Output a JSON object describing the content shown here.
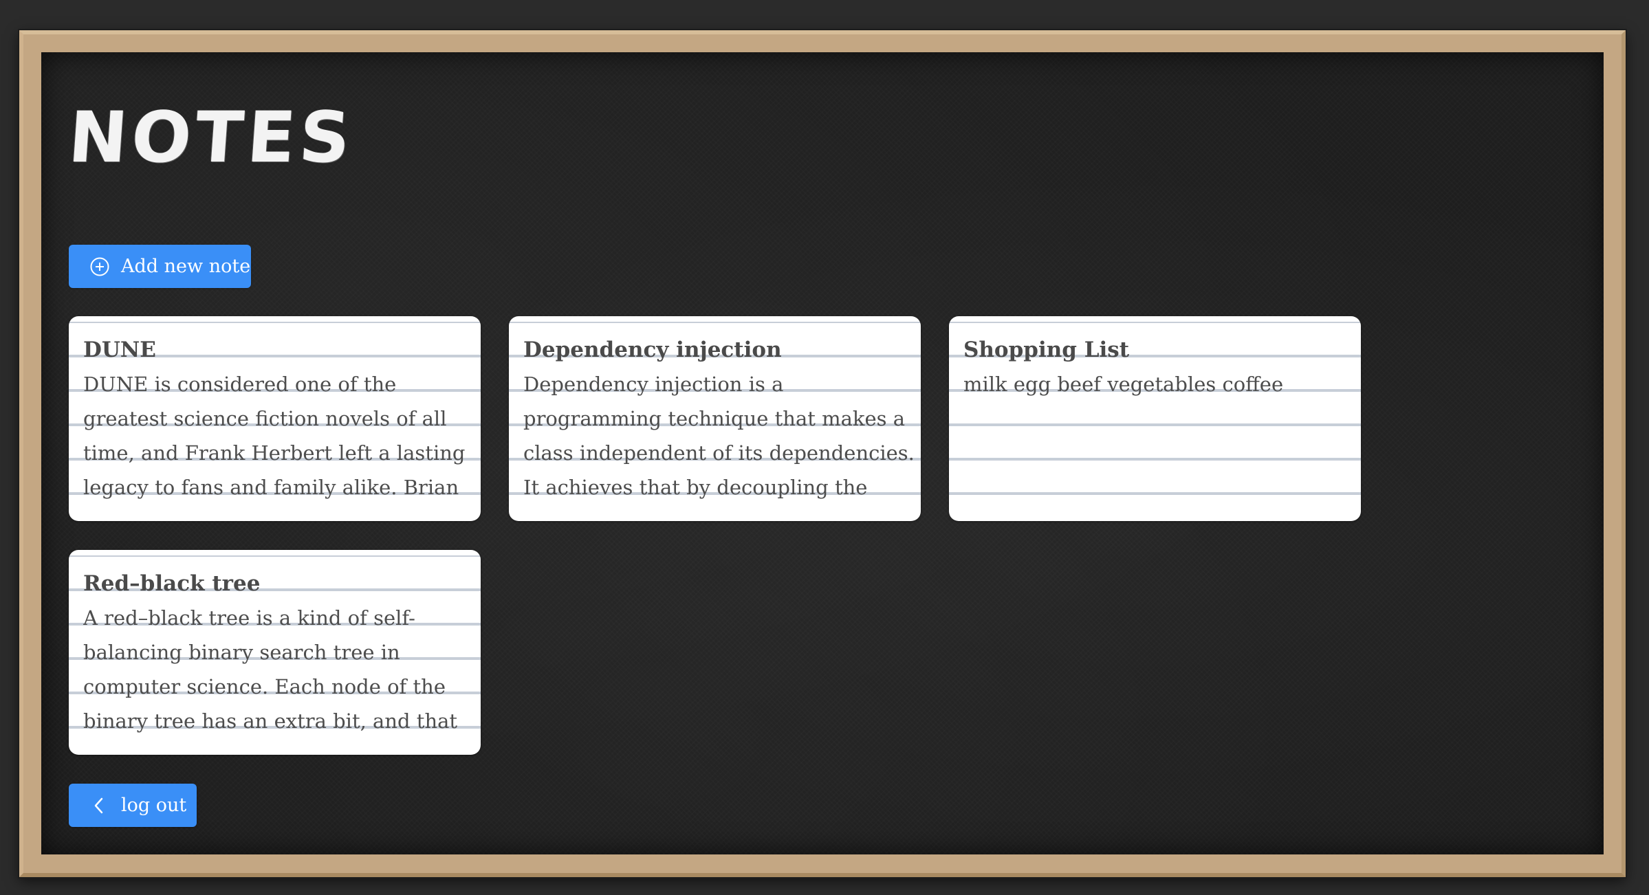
{
  "app": {
    "title": "NOTES"
  },
  "toolbar": {
    "add_note_label": "Add new note",
    "logout_label": "log out"
  },
  "notes": [
    {
      "title": "DUNE",
      "body": "DUNE is considered one of the greatest science fiction novels of all time, and Frank Herbert left a lasting legacy to fans and family alike. Brian Herbert – Frank"
    },
    {
      "title": "Dependency injection",
      "body": "Dependency injection is a programming technique that makes a class independent of its dependencies. It achieves that by decoupling the usage of an object from its"
    },
    {
      "title": "Shopping List",
      "body": "milk egg beef vegetables coffee"
    },
    {
      "title": "Red–black tree",
      "body": "A red–black tree is a kind of self-balancing binary search tree in computer science. Each node of the binary tree has an extra bit, and that bit is often"
    }
  ],
  "icons": {
    "add": "plus-circle-icon",
    "logout": "chevron-left-icon"
  },
  "colors": {
    "accent": "#3a8ff7",
    "board": "#1e1e1e",
    "frame": "#c4a783",
    "rule_line": "#c7ced8"
  }
}
